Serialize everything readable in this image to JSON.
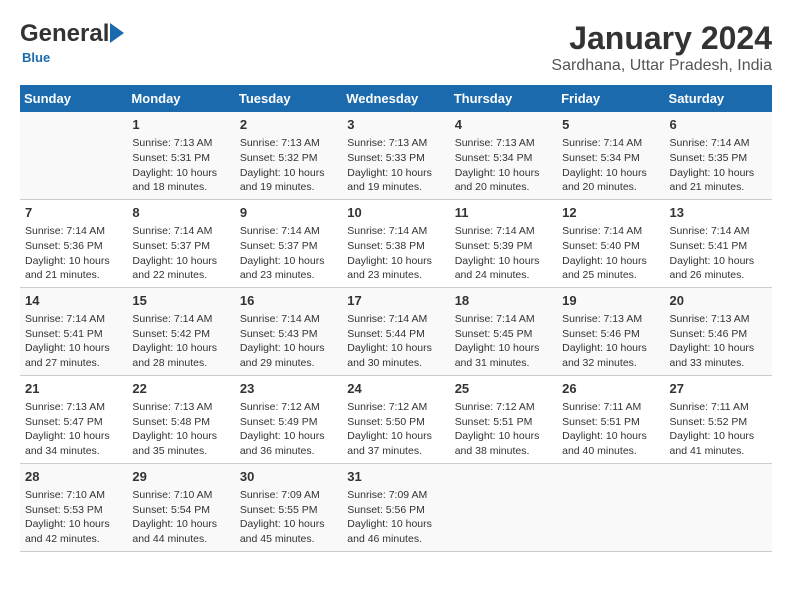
{
  "header": {
    "logo_general": "General",
    "logo_blue": "Blue",
    "title": "January 2024",
    "subtitle": "Sardhana, Uttar Pradesh, India"
  },
  "days_of_week": [
    "Sunday",
    "Monday",
    "Tuesday",
    "Wednesday",
    "Thursday",
    "Friday",
    "Saturday"
  ],
  "weeks": [
    [
      {
        "day": "",
        "info": ""
      },
      {
        "day": "1",
        "info": "Sunrise: 7:13 AM\nSunset: 5:31 PM\nDaylight: 10 hours\nand 18 minutes."
      },
      {
        "day": "2",
        "info": "Sunrise: 7:13 AM\nSunset: 5:32 PM\nDaylight: 10 hours\nand 19 minutes."
      },
      {
        "day": "3",
        "info": "Sunrise: 7:13 AM\nSunset: 5:33 PM\nDaylight: 10 hours\nand 19 minutes."
      },
      {
        "day": "4",
        "info": "Sunrise: 7:13 AM\nSunset: 5:34 PM\nDaylight: 10 hours\nand 20 minutes."
      },
      {
        "day": "5",
        "info": "Sunrise: 7:14 AM\nSunset: 5:34 PM\nDaylight: 10 hours\nand 20 minutes."
      },
      {
        "day": "6",
        "info": "Sunrise: 7:14 AM\nSunset: 5:35 PM\nDaylight: 10 hours\nand 21 minutes."
      }
    ],
    [
      {
        "day": "7",
        "info": "Sunrise: 7:14 AM\nSunset: 5:36 PM\nDaylight: 10 hours\nand 21 minutes."
      },
      {
        "day": "8",
        "info": "Sunrise: 7:14 AM\nSunset: 5:37 PM\nDaylight: 10 hours\nand 22 minutes."
      },
      {
        "day": "9",
        "info": "Sunrise: 7:14 AM\nSunset: 5:37 PM\nDaylight: 10 hours\nand 23 minutes."
      },
      {
        "day": "10",
        "info": "Sunrise: 7:14 AM\nSunset: 5:38 PM\nDaylight: 10 hours\nand 23 minutes."
      },
      {
        "day": "11",
        "info": "Sunrise: 7:14 AM\nSunset: 5:39 PM\nDaylight: 10 hours\nand 24 minutes."
      },
      {
        "day": "12",
        "info": "Sunrise: 7:14 AM\nSunset: 5:40 PM\nDaylight: 10 hours\nand 25 minutes."
      },
      {
        "day": "13",
        "info": "Sunrise: 7:14 AM\nSunset: 5:41 PM\nDaylight: 10 hours\nand 26 minutes."
      }
    ],
    [
      {
        "day": "14",
        "info": "Sunrise: 7:14 AM\nSunset: 5:41 PM\nDaylight: 10 hours\nand 27 minutes."
      },
      {
        "day": "15",
        "info": "Sunrise: 7:14 AM\nSunset: 5:42 PM\nDaylight: 10 hours\nand 28 minutes."
      },
      {
        "day": "16",
        "info": "Sunrise: 7:14 AM\nSunset: 5:43 PM\nDaylight: 10 hours\nand 29 minutes."
      },
      {
        "day": "17",
        "info": "Sunrise: 7:14 AM\nSunset: 5:44 PM\nDaylight: 10 hours\nand 30 minutes."
      },
      {
        "day": "18",
        "info": "Sunrise: 7:14 AM\nSunset: 5:45 PM\nDaylight: 10 hours\nand 31 minutes."
      },
      {
        "day": "19",
        "info": "Sunrise: 7:13 AM\nSunset: 5:46 PM\nDaylight: 10 hours\nand 32 minutes."
      },
      {
        "day": "20",
        "info": "Sunrise: 7:13 AM\nSunset: 5:46 PM\nDaylight: 10 hours\nand 33 minutes."
      }
    ],
    [
      {
        "day": "21",
        "info": "Sunrise: 7:13 AM\nSunset: 5:47 PM\nDaylight: 10 hours\nand 34 minutes."
      },
      {
        "day": "22",
        "info": "Sunrise: 7:13 AM\nSunset: 5:48 PM\nDaylight: 10 hours\nand 35 minutes."
      },
      {
        "day": "23",
        "info": "Sunrise: 7:12 AM\nSunset: 5:49 PM\nDaylight: 10 hours\nand 36 minutes."
      },
      {
        "day": "24",
        "info": "Sunrise: 7:12 AM\nSunset: 5:50 PM\nDaylight: 10 hours\nand 37 minutes."
      },
      {
        "day": "25",
        "info": "Sunrise: 7:12 AM\nSunset: 5:51 PM\nDaylight: 10 hours\nand 38 minutes."
      },
      {
        "day": "26",
        "info": "Sunrise: 7:11 AM\nSunset: 5:51 PM\nDaylight: 10 hours\nand 40 minutes."
      },
      {
        "day": "27",
        "info": "Sunrise: 7:11 AM\nSunset: 5:52 PM\nDaylight: 10 hours\nand 41 minutes."
      }
    ],
    [
      {
        "day": "28",
        "info": "Sunrise: 7:10 AM\nSunset: 5:53 PM\nDaylight: 10 hours\nand 42 minutes."
      },
      {
        "day": "29",
        "info": "Sunrise: 7:10 AM\nSunset: 5:54 PM\nDaylight: 10 hours\nand 44 minutes."
      },
      {
        "day": "30",
        "info": "Sunrise: 7:09 AM\nSunset: 5:55 PM\nDaylight: 10 hours\nand 45 minutes."
      },
      {
        "day": "31",
        "info": "Sunrise: 7:09 AM\nSunset: 5:56 PM\nDaylight: 10 hours\nand 46 minutes."
      },
      {
        "day": "",
        "info": ""
      },
      {
        "day": "",
        "info": ""
      },
      {
        "day": "",
        "info": ""
      }
    ]
  ]
}
